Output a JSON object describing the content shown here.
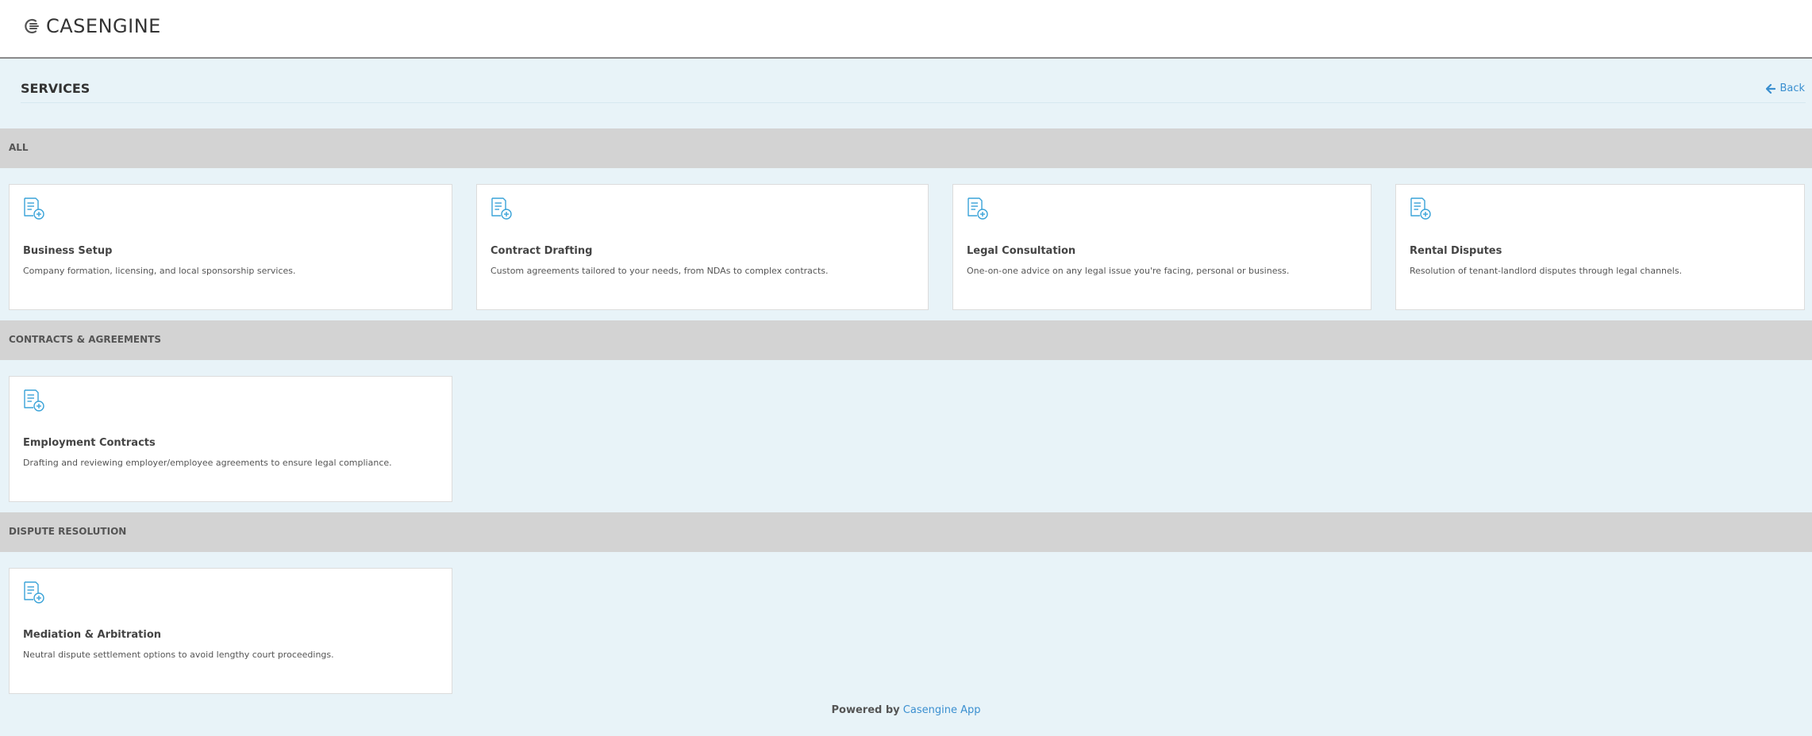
{
  "brand": {
    "name": "CASENGINE"
  },
  "header": {
    "title": "SERVICES",
    "back_label": "Back"
  },
  "sections": [
    {
      "label": "ALL",
      "cards": [
        {
          "title": "Business Setup",
          "desc": "Company formation, licensing, and local sponsorship services."
        },
        {
          "title": "Contract Drafting",
          "desc": "Custom agreements tailored to your needs, from NDAs to complex contracts."
        },
        {
          "title": "Legal Consultation",
          "desc": "One-on-one advice on any legal issue you're facing, personal or business."
        },
        {
          "title": "Rental Disputes",
          "desc": "Resolution of tenant-landlord disputes through legal channels."
        }
      ]
    },
    {
      "label": "CONTRACTS & AGREEMENTS",
      "cards": [
        {
          "title": "Employment Contracts",
          "desc": "Drafting and reviewing employer/employee agreements to ensure legal compliance."
        }
      ]
    },
    {
      "label": "DISPUTE RESOLUTION",
      "cards": [
        {
          "title": "Mediation & Arbitration",
          "desc": "Neutral dispute settlement options to avoid lengthy court proceedings."
        }
      ]
    }
  ],
  "footer": {
    "prefix": "Powered by",
    "link": "Casengine App"
  },
  "icons": {
    "card": "document-add-icon",
    "back": "arrow-left-icon",
    "logo": "casengine-logo-icon"
  },
  "colors": {
    "accent": "#3a8fd0",
    "icon": "#3aa3d8",
    "background": "#e8f3f8",
    "section_bar": "#d3d3d3"
  }
}
